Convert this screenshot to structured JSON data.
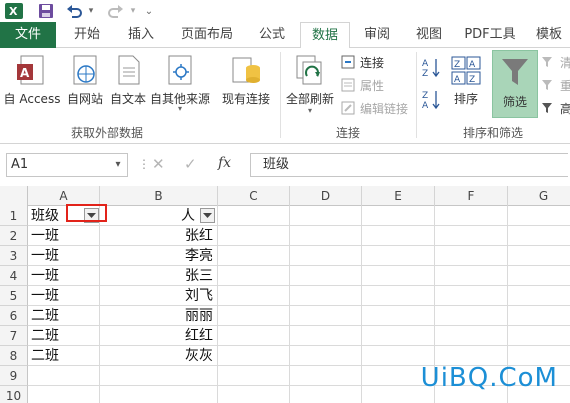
{
  "tabs": [
    "文件",
    "开始",
    "插入",
    "页面布局",
    "公式",
    "数据",
    "审阅",
    "视图",
    "PDF工具",
    "模板"
  ],
  "ribbon": {
    "get_external": {
      "buttons": [
        "自 Access",
        "自网站",
        "自文本",
        "自其他来源"
      ],
      "label": "获取外部数据"
    },
    "existing_conn": "现有连接",
    "connections": {
      "refresh_all": "全部刷新",
      "items": [
        "连接",
        "属性",
        "编辑链接"
      ],
      "label": "连接"
    },
    "sort_filter": {
      "sort": "排序",
      "filter": "筛选",
      "side_items": [
        "清",
        "重",
        "高"
      ],
      "label": "排序和筛选"
    }
  },
  "formula_bar": {
    "name_box": "A1",
    "fx": "fx",
    "value": "班级"
  },
  "grid": {
    "columns": [
      "A",
      "B",
      "C",
      "D",
      "E",
      "F",
      "G"
    ],
    "rows": [
      {
        "num": "1",
        "a": "班级",
        "b": "人"
      },
      {
        "num": "2",
        "a": "一班",
        "b": "张红"
      },
      {
        "num": "3",
        "a": "一班",
        "b": "李亮"
      },
      {
        "num": "4",
        "a": "一班",
        "b": "张三"
      },
      {
        "num": "5",
        "a": "一班",
        "b": "刘飞"
      },
      {
        "num": "6",
        "a": "二班",
        "b": "丽丽"
      },
      {
        "num": "7",
        "a": "二班",
        "b": "红红"
      },
      {
        "num": "8",
        "a": "二班",
        "b": "灰灰"
      },
      {
        "num": "9",
        "a": "",
        "b": ""
      },
      {
        "num": "10",
        "a": "",
        "b": ""
      }
    ]
  },
  "watermark": "UiBQ.CoM",
  "colors": {
    "excel_green": "#217346",
    "highlight_red": "#e2231a",
    "watermark_blue": "#1c8fd6"
  }
}
